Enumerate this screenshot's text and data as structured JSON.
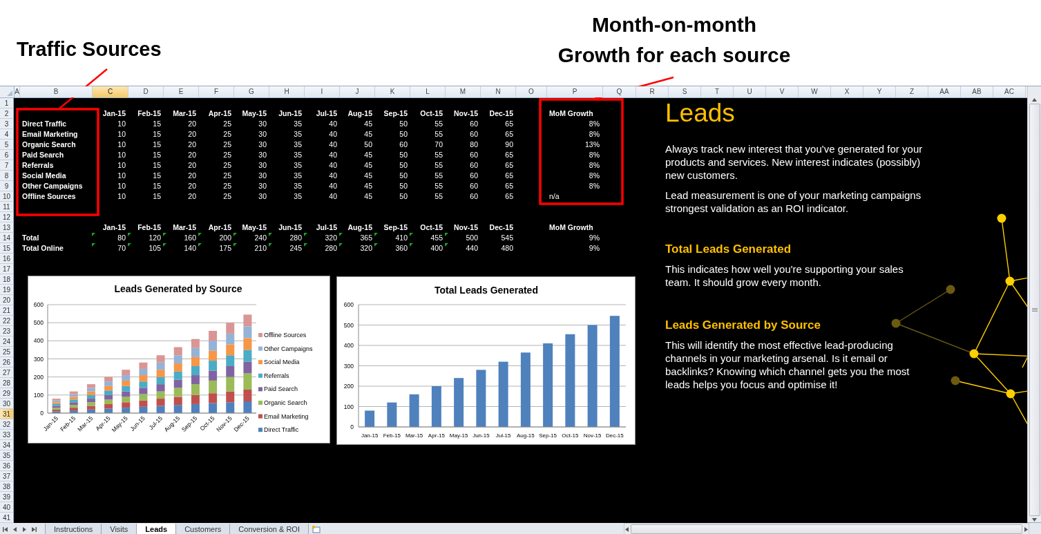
{
  "annotations": {
    "left": {
      "lines": [
        "Traffic Sources"
      ]
    },
    "right": {
      "lines": [
        "Month-on-month",
        "Growth for each source"
      ]
    }
  },
  "column_headers": [
    {
      "label": "A",
      "selected": false
    },
    {
      "label": "B",
      "selected": false
    },
    {
      "label": "C",
      "selected": true
    },
    {
      "label": "D",
      "selected": false
    },
    {
      "label": "E",
      "selected": false
    },
    {
      "label": "F",
      "selected": false
    },
    {
      "label": "G",
      "selected": false
    },
    {
      "label": "H",
      "selected": false
    },
    {
      "label": "I",
      "selected": false
    },
    {
      "label": "J",
      "selected": false
    },
    {
      "label": "K",
      "selected": false
    },
    {
      "label": "L",
      "selected": false
    },
    {
      "label": "M",
      "selected": false
    },
    {
      "label": "N",
      "selected": false
    },
    {
      "label": "O",
      "selected": false
    },
    {
      "label": "P",
      "selected": false
    },
    {
      "label": "Q",
      "selected": false
    },
    {
      "label": "R",
      "selected": false
    },
    {
      "label": "S",
      "selected": false
    },
    {
      "label": "T",
      "selected": false
    },
    {
      "label": "U",
      "selected": false
    },
    {
      "label": "V",
      "selected": false
    },
    {
      "label": "W",
      "selected": false
    },
    {
      "label": "X",
      "selected": false
    },
    {
      "label": "Y",
      "selected": false
    },
    {
      "label": "Z",
      "selected": false
    },
    {
      "label": "AA",
      "selected": false
    },
    {
      "label": "AB",
      "selected": false
    },
    {
      "label": "AC",
      "selected": false
    }
  ],
  "row_numbers": [
    {
      "label": "1",
      "selected": false
    },
    {
      "label": "2",
      "selected": false
    },
    {
      "label": "3",
      "selected": false
    },
    {
      "label": "4",
      "selected": false
    },
    {
      "label": "5",
      "selected": false
    },
    {
      "label": "6",
      "selected": false
    },
    {
      "label": "7",
      "selected": false
    },
    {
      "label": "8",
      "selected": false
    },
    {
      "label": "9",
      "selected": false
    },
    {
      "label": "10",
      "selected": false
    },
    {
      "label": "11",
      "selected": false
    },
    {
      "label": "12",
      "selected": false
    },
    {
      "label": "13",
      "selected": false
    },
    {
      "label": "14",
      "selected": false
    },
    {
      "label": "15",
      "selected": false
    },
    {
      "label": "16",
      "selected": false
    },
    {
      "label": "17",
      "selected": false
    },
    {
      "label": "18",
      "selected": false
    },
    {
      "label": "19",
      "selected": false
    },
    {
      "label": "20",
      "selected": false
    },
    {
      "label": "21",
      "selected": false
    },
    {
      "label": "22",
      "selected": false
    },
    {
      "label": "23",
      "selected": false
    },
    {
      "label": "24",
      "selected": false
    },
    {
      "label": "25",
      "selected": false
    },
    {
      "label": "26",
      "selected": false
    },
    {
      "label": "27",
      "selected": false
    },
    {
      "label": "28",
      "selected": false
    },
    {
      "label": "29",
      "selected": false
    },
    {
      "label": "30",
      "selected": false
    },
    {
      "label": "31",
      "selected": true
    },
    {
      "label": "32",
      "selected": false
    },
    {
      "label": "33",
      "selected": false
    },
    {
      "label": "34",
      "selected": false
    },
    {
      "label": "35",
      "selected": false
    },
    {
      "label": "36",
      "selected": false
    },
    {
      "label": "37",
      "selected": false
    },
    {
      "label": "38",
      "selected": false
    },
    {
      "label": "39",
      "selected": false
    },
    {
      "label": "40",
      "selected": false
    },
    {
      "label": "41",
      "selected": false
    }
  ],
  "source_table": {
    "months": [
      "Jan-15",
      "Feb-15",
      "Mar-15",
      "Apr-15",
      "May-15",
      "Jun-15",
      "Jul-15",
      "Aug-15",
      "Sep-15",
      "Oct-15",
      "Nov-15",
      "Dec-15"
    ],
    "growth_header": "MoM Growth",
    "rows": [
      {
        "name": "Direct Traffic",
        "values": [
          "10",
          "15",
          "20",
          "25",
          "30",
          "35",
          "40",
          "45",
          "50",
          "55",
          "60",
          "65"
        ],
        "growth": {
          "text": "8%",
          "kind": "number"
        }
      },
      {
        "name": "Email Marketing",
        "values": [
          "10",
          "15",
          "20",
          "25",
          "30",
          "35",
          "40",
          "45",
          "50",
          "55",
          "60",
          "65"
        ],
        "growth": {
          "text": "8%",
          "kind": "number"
        }
      },
      {
        "name": "Organic Search",
        "values": [
          "10",
          "15",
          "20",
          "25",
          "30",
          "35",
          "40",
          "50",
          "60",
          "70",
          "80",
          "90"
        ],
        "growth": {
          "text": "13%",
          "kind": "number"
        }
      },
      {
        "name": "Paid Search",
        "values": [
          "10",
          "15",
          "20",
          "25",
          "30",
          "35",
          "40",
          "45",
          "50",
          "55",
          "60",
          "65"
        ],
        "growth": {
          "text": "8%",
          "kind": "number"
        }
      },
      {
        "name": "Referrals",
        "values": [
          "10",
          "15",
          "20",
          "25",
          "30",
          "35",
          "40",
          "45",
          "50",
          "55",
          "60",
          "65"
        ],
        "growth": {
          "text": "8%",
          "kind": "number"
        }
      },
      {
        "name": "Social Media",
        "values": [
          "10",
          "15",
          "20",
          "25",
          "30",
          "35",
          "40",
          "45",
          "50",
          "55",
          "60",
          "65"
        ],
        "growth": {
          "text": "8%",
          "kind": "number"
        }
      },
      {
        "name": "Other Campaigns",
        "values": [
          "10",
          "15",
          "20",
          "25",
          "30",
          "35",
          "40",
          "45",
          "50",
          "55",
          "60",
          "65"
        ],
        "growth": {
          "text": "8%",
          "kind": "number"
        }
      },
      {
        "name": "Offline Sources",
        "values": [
          "10",
          "15",
          "20",
          "25",
          "30",
          "35",
          "40",
          "45",
          "50",
          "55",
          "60",
          "65"
        ],
        "growth": {
          "text": "n/a",
          "kind": "text"
        }
      }
    ]
  },
  "totals_table": {
    "months": [
      "Jan-15",
      "Feb-15",
      "Mar-15",
      "Apr-15",
      "May-15",
      "Jun-15",
      "Jul-15",
      "Aug-15",
      "Sep-15",
      "Oct-15",
      "Nov-15",
      "Dec-15"
    ],
    "growth_header": "MoM Growth",
    "rows": [
      {
        "name": "Total",
        "values": [
          {
            "text": "80",
            "flagged": true
          },
          {
            "text": "120",
            "flagged": true
          },
          {
            "text": "160",
            "flagged": true
          },
          {
            "text": "200",
            "flagged": true
          },
          {
            "text": "240",
            "flagged": true
          },
          {
            "text": "280",
            "flagged": true
          },
          {
            "text": "320",
            "flagged": true
          },
          {
            "text": "365",
            "flagged": true
          },
          {
            "text": "410",
            "flagged": true
          },
          {
            "text": "455",
            "flagged": true
          },
          {
            "text": "500",
            "flagged": true
          },
          {
            "text": "545",
            "flagged": false
          }
        ],
        "growth": {
          "text": "9%",
          "kind": "number"
        }
      },
      {
        "name": "Total Online",
        "values": [
          {
            "text": "70",
            "flagged": true
          },
          {
            "text": "105",
            "flagged": true
          },
          {
            "text": "140",
            "flagged": true
          },
          {
            "text": "175",
            "flagged": true
          },
          {
            "text": "210",
            "flagged": true
          },
          {
            "text": "245",
            "flagged": true
          },
          {
            "text": "280",
            "flagged": true
          },
          {
            "text": "320",
            "flagged": true
          },
          {
            "text": "360",
            "flagged": true
          },
          {
            "text": "400",
            "flagged": true
          },
          {
            "text": "440",
            "flagged": true
          },
          {
            "text": "480",
            "flagged": false
          }
        ],
        "growth": {
          "text": "9%",
          "kind": "number"
        }
      }
    ]
  },
  "charts": [
    {
      "chart_data": {
        "type": "bar",
        "title": "Leads Generated by Source",
        "stacked": true,
        "grid": true,
        "legend": true,
        "categories": [
          "Jan-15",
          "Feb-15",
          "Mar-15",
          "Apr-15",
          "May-15",
          "Jun-15",
          "Jul-15",
          "Aug-15",
          "Sep-15",
          "Oct-15",
          "Nov-15",
          "Dec-15"
        ],
        "ylim": [
          0,
          600
        ],
        "yticks": [
          0,
          100,
          200,
          300,
          400,
          500,
          600
        ],
        "series": [
          {
            "name": "Direct Traffic",
            "color": "#4f81bd",
            "values": [
              10,
              15,
              20,
              25,
              30,
              35,
              40,
              45,
              50,
              55,
              60,
              65
            ]
          },
          {
            "name": "Email Marketing",
            "color": "#c0504d",
            "values": [
              10,
              15,
              20,
              25,
              30,
              35,
              40,
              45,
              50,
              55,
              60,
              65
            ]
          },
          {
            "name": "Organic Search",
            "color": "#9bbb59",
            "values": [
              10,
              15,
              20,
              25,
              30,
              35,
              40,
              50,
              60,
              70,
              80,
              90
            ]
          },
          {
            "name": "Paid Search",
            "color": "#8064a2",
            "values": [
              10,
              15,
              20,
              25,
              30,
              35,
              40,
              45,
              50,
              55,
              60,
              65
            ]
          },
          {
            "name": "Referrals",
            "color": "#4bacc6",
            "values": [
              10,
              15,
              20,
              25,
              30,
              35,
              40,
              45,
              50,
              55,
              60,
              65
            ]
          },
          {
            "name": "Social Media",
            "color": "#f79646",
            "values": [
              10,
              15,
              20,
              25,
              30,
              35,
              40,
              45,
              50,
              55,
              60,
              65
            ]
          },
          {
            "name": "Other Campaigns",
            "color": "#95b3d7",
            "values": [
              10,
              15,
              20,
              25,
              30,
              35,
              40,
              45,
              50,
              55,
              60,
              65
            ]
          },
          {
            "name": "Offline Sources",
            "color": "#d99694",
            "values": [
              10,
              15,
              20,
              25,
              30,
              35,
              40,
              45,
              50,
              55,
              60,
              65
            ]
          }
        ]
      }
    },
    {
      "chart_data": {
        "type": "bar",
        "title": "Total Leads Generated",
        "grid": true,
        "categories": [
          "Jan-15",
          "Feb-15",
          "Mar-15",
          "Apr-15",
          "May-15",
          "Jun-15",
          "Jul-15",
          "Aug-15",
          "Sep-15",
          "Oct-15",
          "Nov-15",
          "Dec-15"
        ],
        "ylim": [
          0,
          600
        ],
        "yticks": [
          0,
          100,
          200,
          300,
          400,
          500,
          600
        ],
        "series": [
          {
            "color": "#4f81bd",
            "values": [
              80,
              120,
              160,
              200,
              240,
              280,
              320,
              365,
              410,
              455,
              500,
              545
            ]
          }
        ]
      }
    }
  ],
  "info_panel": {
    "title": "Leads",
    "intro": [
      [
        "Always track new interest that you've generated for your",
        "products and services.  New interest indicates (possibly)",
        "new  customers."
      ],
      [
        "Lead measurement is one of your marketing campaigns",
        "strongest validation as an ROI indicator."
      ]
    ],
    "sections": [
      {
        "heading": "Total Leads Generated",
        "lines": [
          "This indicates how well you're supporting your sales",
          "team. It should grow every month."
        ]
      },
      {
        "heading": "Leads Generated by Source",
        "lines": [
          "This will identify the most effective lead-producing",
          "channels in your marketing arsenal. Is it email or",
          "backlinks? Knowing which channel gets you the most",
          "leads helps you focus and optimise it!"
        ]
      }
    ]
  },
  "sheet_tabs": [
    {
      "label": "Instructions",
      "selected": false
    },
    {
      "label": "Visits",
      "selected": false
    },
    {
      "label": "Leads",
      "selected": true
    },
    {
      "label": "Customers",
      "selected": false
    },
    {
      "label": "Conversion & ROI",
      "selected": false
    }
  ]
}
